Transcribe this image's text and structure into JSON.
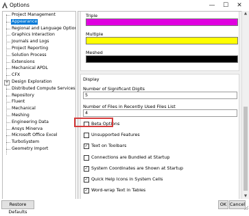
{
  "window": {
    "title": "Options",
    "minimize": "—",
    "maximize": "☐",
    "close": "✕"
  },
  "tree": {
    "items": [
      {
        "label": "Project Management"
      },
      {
        "label": "Appearance",
        "selected": true
      },
      {
        "label": "Regional and Language Options"
      },
      {
        "label": "Graphics Interaction"
      },
      {
        "label": "Journals and Logs"
      },
      {
        "label": "Project Reporting"
      },
      {
        "label": "Solution Process"
      },
      {
        "label": "Extensions"
      },
      {
        "label": "Mechanical APDL"
      },
      {
        "label": "CFX"
      },
      {
        "label": "Design Exploration",
        "expander": "+"
      },
      {
        "label": "Distributed Compute Services"
      },
      {
        "label": "Repository"
      },
      {
        "label": "Fluent"
      },
      {
        "label": "Mechanical"
      },
      {
        "label": "Meshing"
      },
      {
        "label": "Engineering Data"
      },
      {
        "label": "Ansys Minerva"
      },
      {
        "label": "Microsoft Office Excel"
      },
      {
        "label": "TurboSystem"
      },
      {
        "label": "Geometry Import"
      }
    ]
  },
  "colors": {
    "triple": {
      "label": "Triple",
      "hex": "#e000e0"
    },
    "multiple": {
      "label": "Multiple",
      "hex": "#ffff00"
    },
    "meshed": {
      "label": "Meshed",
      "hex": "#000000"
    }
  },
  "display": {
    "heading": "Display",
    "sig_digits_label": "Number of Significant Digits",
    "sig_digits_value": "5",
    "recent_files_label": "Number of Files in Recently Used Files List",
    "recent_files_value": "4",
    "checkboxes": [
      {
        "label": "Beta Options",
        "checked": false
      },
      {
        "label": "Unsupported Features",
        "checked": false
      },
      {
        "label": "Text on Toolbars",
        "checked": true
      },
      {
        "label": "Connections are Bundled at Startup",
        "checked": false
      },
      {
        "label": "System Coordinates are Shown at Startup",
        "checked": true
      },
      {
        "label": "Quick Help Icons in System Cells",
        "checked": true
      },
      {
        "label": "Word-wrap Text in Tables",
        "checked": true
      }
    ]
  },
  "footer": {
    "restore_label": "Restore Defaults",
    "ok_label": "OK",
    "cancel_label": "Cancel"
  }
}
